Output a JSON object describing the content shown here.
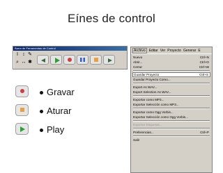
{
  "title": "Eínes de control",
  "toolbar": {
    "window_title": "Barra de Ferramentas de Control",
    "tools": [
      {
        "icon": "i-beam-cursor-icon",
        "glyph": "I"
      },
      {
        "icon": "envelope-tool-icon",
        "glyph": "↕"
      },
      {
        "icon": "zoom-icon",
        "glyph": "⌕"
      },
      {
        "icon": "time-shift-icon",
        "glyph": "↔"
      },
      {
        "icon": "draw-tool-icon",
        "glyph": "✎"
      },
      {
        "icon": "multi-tool-icon",
        "glyph": "✱"
      }
    ],
    "buttons": [
      {
        "icon": "skip-to-start-icon"
      },
      {
        "icon": "play-icon"
      },
      {
        "icon": "record-icon"
      },
      {
        "icon": "pause-icon"
      },
      {
        "icon": "stop-icon"
      },
      {
        "icon": "skip-to-end-icon"
      }
    ]
  },
  "menu": {
    "bar": [
      "Archivo",
      "Editar",
      "Ver",
      "Proyecto",
      "Generar",
      "E"
    ],
    "items": [
      {
        "label": "Nuevo",
        "shortcut": "Ctrl+N"
      },
      {
        "label": "Abrir...",
        "shortcut": "Ctrl+O"
      },
      {
        "label": "Cerrar",
        "shortcut": "Ctrl+W"
      },
      {
        "label": "Guardar Proyecto",
        "shortcut": "Ctrl+S"
      },
      {
        "label": "Guardar Proyecto Como...",
        "shortcut": ""
      },
      {
        "label": "Export As WAV...",
        "shortcut": ""
      },
      {
        "label": "Export Selection As WAV...",
        "shortcut": ""
      },
      {
        "label": "Exportar como MP3...",
        "shortcut": ""
      },
      {
        "label": "Exportar Selección como MP3...",
        "shortcut": ""
      },
      {
        "label": "Exportar como Ogg Vorbis...",
        "shortcut": ""
      },
      {
        "label": "Exportar Selección como Ogg Vorbis...",
        "shortcut": ""
      },
      {
        "label": "Exportar Etiquetas...",
        "shortcut": ""
      },
      {
        "label": "Preferencias...",
        "shortcut": "Ctrl+P"
      },
      {
        "label": "Salir",
        "shortcut": ""
      }
    ]
  },
  "rows": [
    {
      "label": "Gravar",
      "icon": "record-icon",
      "color": "#c84040"
    },
    {
      "label": "Aturar",
      "icon": "stop-icon",
      "color": "#e8a040"
    },
    {
      "label": "Play",
      "icon": "play-icon",
      "color": "#2e9e3a"
    }
  ]
}
